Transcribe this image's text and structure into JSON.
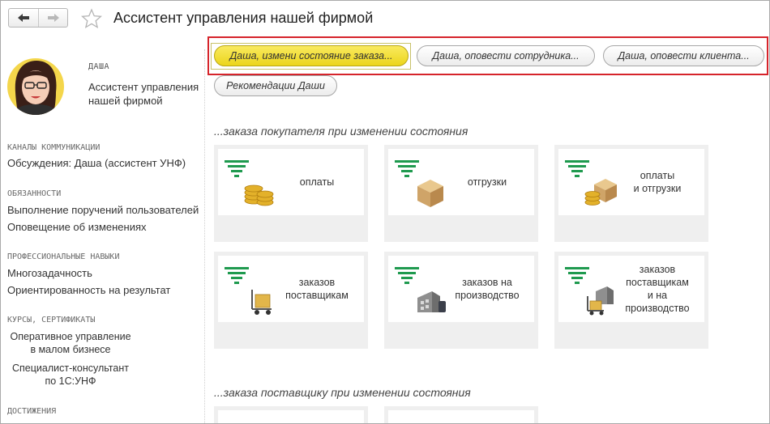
{
  "window": {
    "title": "Ассистент управления нашей фирмой"
  },
  "nav": {
    "back_icon": "arrow-left-icon",
    "forward_icon": "arrow-right-icon",
    "favorite_icon": "star-icon"
  },
  "persona": {
    "name": "ДАША",
    "role": "Ассистент управления нашей фирмой"
  },
  "sidebar": {
    "channels": {
      "heading": "КАНАЛЫ КОММУНИКАЦИИ",
      "items": [
        "Обсуждения: Даша (ассистент УНФ)"
      ]
    },
    "duties": {
      "heading": "ОБЯЗАННОСТИ",
      "items": [
        "Выполнение поручений пользователей",
        "Оповещение об изменениях"
      ]
    },
    "skills": {
      "heading": "ПРОФЕССИОНАЛЬНЫЕ НАВЫКИ",
      "items": [
        "Многозадачность",
        "Ориентированность на результат"
      ]
    },
    "courses": {
      "heading": "КУРСЫ, СЕРТИФИКАТЫ",
      "items": [
        "Оперативное управление\nв малом бизнесе",
        "Специалист-консультант\nпо 1С:УНФ"
      ]
    },
    "achievements": {
      "heading": "ДОСТИЖЕНИЯ"
    }
  },
  "commands": [
    {
      "label": "Даша, измени состояние заказа..."
    },
    {
      "label": "Даша, оповести сотрудника..."
    },
    {
      "label": "Даша, оповести клиента..."
    },
    {
      "label": "Рекомендации Даши"
    }
  ],
  "groups": [
    {
      "title": "...заказа покупателя при изменении состояния",
      "tiles": [
        {
          "label": "оплаты",
          "icon": "coins-icon"
        },
        {
          "label": "отгрузки",
          "icon": "box-icon"
        },
        {
          "label": "оплаты\nи отгрузки",
          "icon": "box-coins-icon"
        },
        {
          "label": "заказов\nпоставщикам",
          "icon": "cart-icon"
        },
        {
          "label": "заказов на\nпроизводство",
          "icon": "factory-icon"
        },
        {
          "label": "заказов\nпоставщикам\nи на\nпроизводство",
          "icon": "factory-cart-icon"
        }
      ]
    },
    {
      "title": "...заказа поставщику при изменении состояния"
    }
  ],
  "colors": {
    "accent_yellow": "#ecd51b",
    "highlight_red": "#d6242b",
    "funnel_green": "#1f9a4f",
    "tile_bg": "#efefef"
  }
}
